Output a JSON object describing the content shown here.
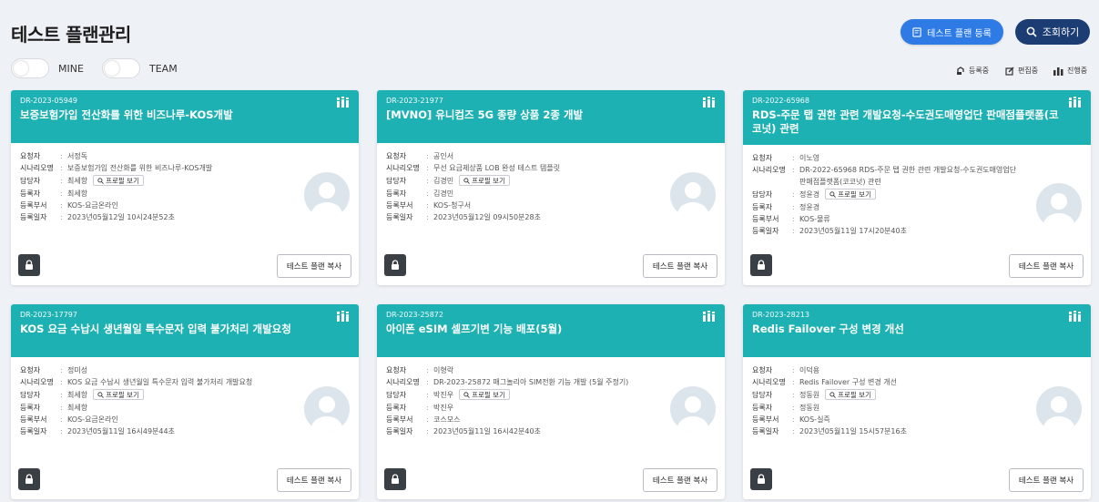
{
  "header": {
    "title": "테스트 플랜관리",
    "register_label": "테스트 플랜 등록",
    "search_label": "조회하기"
  },
  "filters": {
    "mine_label": "MINE",
    "team_label": "TEAM"
  },
  "legend": {
    "registered": "등록중",
    "editing": "편집중",
    "in_progress": "진행중"
  },
  "field_labels": {
    "requester": "요청자",
    "scenario": "시나리오명",
    "manager": "담당자",
    "registrant": "등록자",
    "dept": "등록부서",
    "date": "등록일자",
    "profile_btn": "프로필 보기",
    "copy_btn": "테스트 플랜 복사"
  },
  "cards": [
    {
      "code": "DR-2023-05949",
      "title": "보증보험가입 전산화를 위한 비즈나루-KOS개발",
      "requester": "서정독",
      "scenario": "보증보험가입 전산화를 위한 비즈나루-KOS개발",
      "manager": "최세항",
      "registrant": "최세항",
      "dept": "KOS-요금온라인",
      "date": "2023년05월12일 10시24분52초"
    },
    {
      "code": "DR-2023-21977",
      "title": "[MVNO] 유니컴즈 5G 종량 상품 2종 개발",
      "requester": "공인서",
      "scenario": "무선 요금제상품 LOB 완성 테스트 템플릿",
      "manager": "김경민",
      "registrant": "김경민",
      "dept": "KOS-청구서",
      "date": "2023년05월12일 09시50분28초"
    },
    {
      "code": "DR-2022-65968",
      "title": "RDS-주문 탭 권한 관련 개발요청-수도권도매영업단 판매점플랫폼(코코넛) 관련",
      "requester": "이노영",
      "scenario": "DR-2022-65968 RDS-주문 탭 권한 관련 개발요청-수도권도매영업단 판매점플랫폼(코코넛) 관련",
      "manager": "정윤경",
      "registrant": "정윤경",
      "dept": "KOS-물류",
      "date": "2023년05월11일 17시20분40초"
    },
    {
      "code": "DR-2023-17797",
      "title": "KOS 요금 수납시 생년월일 특수문자 입력 불가처리 개발요청",
      "requester": "정미성",
      "scenario": "KOS 요금 수납시 생년월일 특수문자 입력 불가처리 개발요청",
      "manager": "최세항",
      "registrant": "최세항",
      "dept": "KOS-요금온라인",
      "date": "2023년05월11일 16시49분44초"
    },
    {
      "code": "DR-2023-25872",
      "title": "아이폰 eSIM 셀프기변 기능 배포(5월)",
      "requester": "이형락",
      "scenario": "DR-2023-25872 매그놀리아 SIM전환 기능 개발 (5월 주정기)",
      "manager": "박진우",
      "registrant": "박진우",
      "dept": "코스모스",
      "date": "2023년05월11일 16시42분40초"
    },
    {
      "code": "DR-2023-28213",
      "title": "Redis Failover 구성 변경 개선",
      "requester": "이덕용",
      "scenario": "Redis Failover 구성 변경 개선",
      "manager": "정동원",
      "registrant": "정동원",
      "dept": "KOS-실즉",
      "date": "2023년05월11일 15시57분16초"
    }
  ]
}
